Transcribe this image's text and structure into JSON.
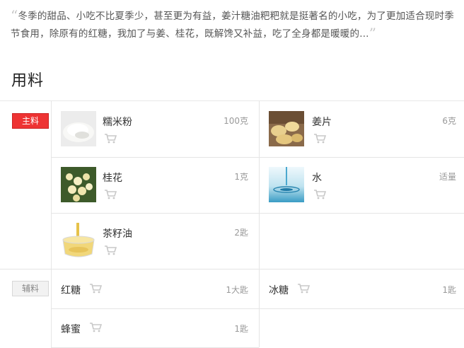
{
  "intro": {
    "open_quote": "“",
    "text": "冬季的甜品、小吃不比夏季少，甚至更为有益，姜汁糖油粑粑就是挺著名的小吃，为了更加适合现时季节食用，除原有的红糖，我加了与姜、桂花，既解馋又补益，吃了全身都是暖暖的...",
    "close_quote": "”"
  },
  "section_title": "用料",
  "groups": {
    "main_label": "主料",
    "sub_label": "辅料"
  },
  "main_items": [
    {
      "name": "糯米粉",
      "qty": "100克",
      "icon": "glutinous-rice-flour-photo"
    },
    {
      "name": "姜片",
      "qty": "6克",
      "icon": "ginger-slices-photo"
    },
    {
      "name": "桂花",
      "qty": "1克",
      "icon": "osmanthus-photo"
    },
    {
      "name": "水",
      "qty": "适量",
      "icon": "water-photo"
    },
    {
      "name": "茶籽油",
      "qty": "2匙",
      "icon": "tea-seed-oil-photo"
    }
  ],
  "sub_items": [
    {
      "name": "红糖",
      "qty": "1大匙"
    },
    {
      "name": "冰糖",
      "qty": "1匙"
    },
    {
      "name": "蜂蜜",
      "qty": "1匙"
    }
  ],
  "colors": {
    "accent_red": "#ee3333",
    "cart_icon": "#c8c8c8"
  }
}
